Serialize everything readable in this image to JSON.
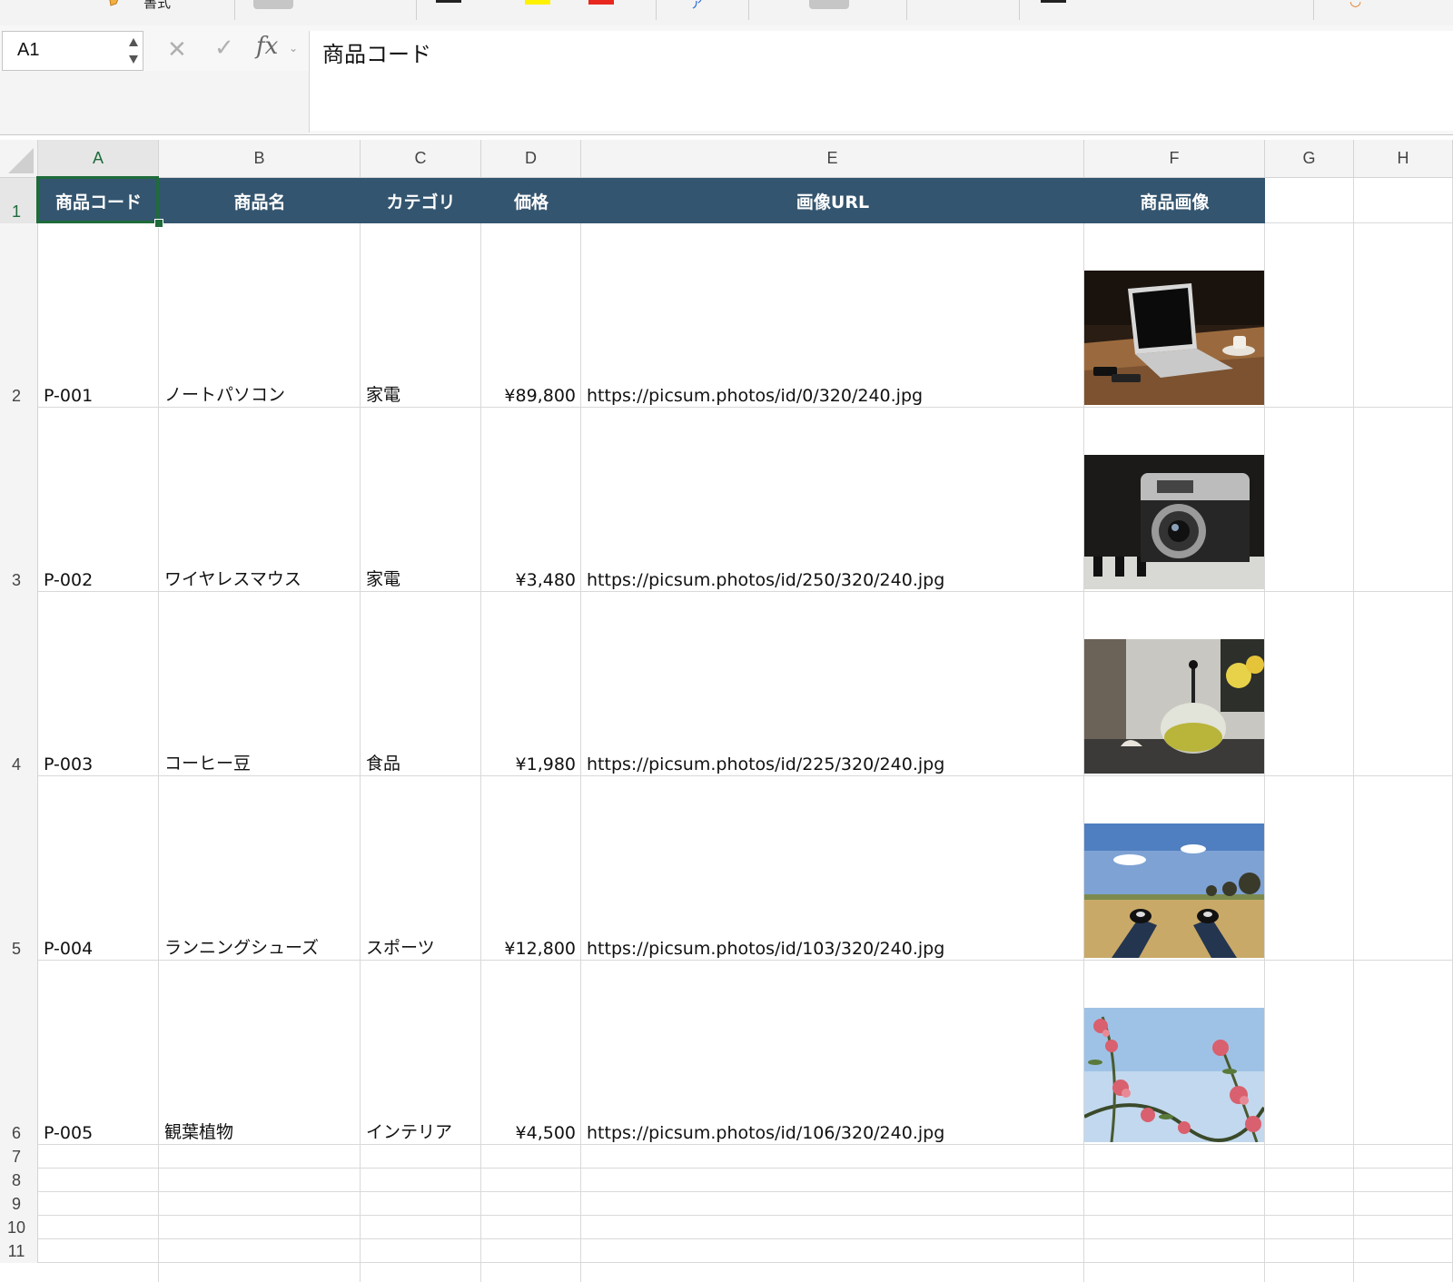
{
  "ribbon": {
    "format_label": "書式"
  },
  "formula_bar": {
    "name_box": "A1",
    "cancel_glyph": "✕",
    "enter_glyph": "✓",
    "fx_label": "fx",
    "content": "商品コード"
  },
  "columns": [
    "A",
    "B",
    "C",
    "D",
    "E",
    "F",
    "G",
    "H"
  ],
  "rows": [
    "1",
    "2",
    "3",
    "4",
    "5",
    "6",
    "7",
    "8",
    "9",
    "10",
    "11"
  ],
  "table": {
    "headers": [
      "商品コード",
      "商品名",
      "カテゴリ",
      "価格",
      "画像URL",
      "商品画像"
    ],
    "records": [
      {
        "code": "P-001",
        "name": "ノートパソコン",
        "category": "家電",
        "price": "¥89,800",
        "url": "https://picsum.photos/id/0/320/240.jpg",
        "image": "laptop-on-wooden-table"
      },
      {
        "code": "P-002",
        "name": "ワイヤレスマウス",
        "category": "家電",
        "price": "¥3,480",
        "url": "https://picsum.photos/id/250/320/240.jpg",
        "image": "vintage-camera"
      },
      {
        "code": "P-003",
        "name": "コーヒー豆",
        "category": "食品",
        "price": "¥1,980",
        "url": "https://picsum.photos/id/225/320/240.jpg",
        "image": "glass-teapot"
      },
      {
        "code": "P-004",
        "name": "ランニングシューズ",
        "category": "スポーツ",
        "price": "¥12,800",
        "url": "https://picsum.photos/id/103/320/240.jpg",
        "image": "sneakers-in-field"
      },
      {
        "code": "P-005",
        "name": "観葉植物",
        "category": "インテリア",
        "price": "¥4,500",
        "url": "https://picsum.photos/id/106/320/240.jpg",
        "image": "pink-flowers-sky"
      }
    ]
  },
  "colors": {
    "header_fill": "#34556f",
    "selection": "#1e6b3b"
  }
}
